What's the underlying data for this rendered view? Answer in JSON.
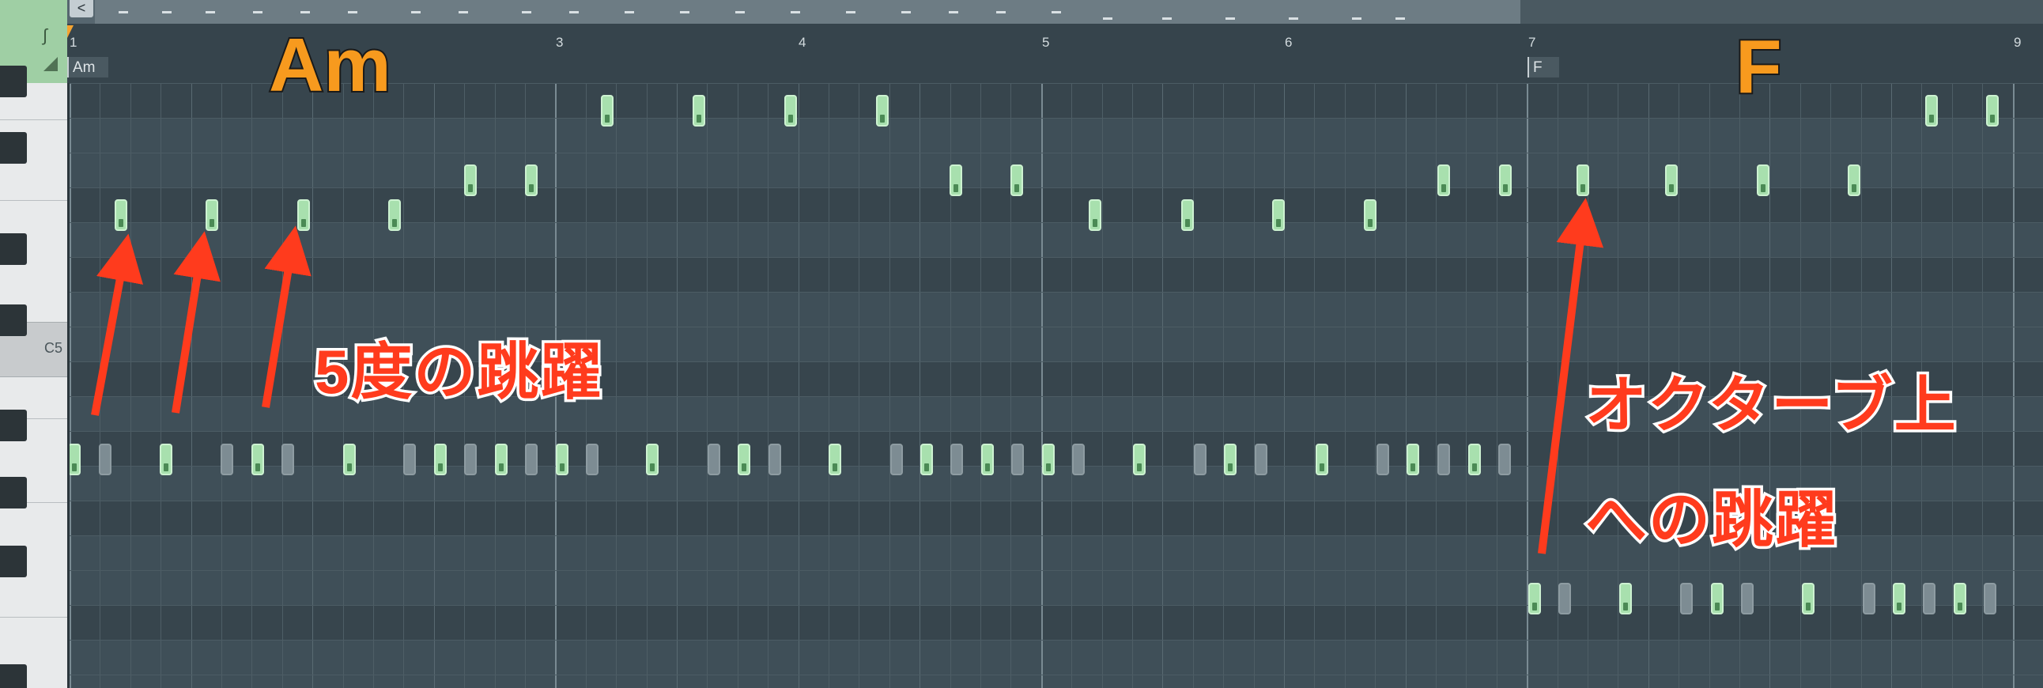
{
  "overview": {
    "scroll_left_glyph": "<"
  },
  "corner": {
    "tool_glyph": "∫"
  },
  "ruler": {
    "bar_numbers": [
      {
        "label": "1"
      },
      {
        "label": "3"
      },
      {
        "label": "4"
      },
      {
        "label": "5"
      },
      {
        "label": "6"
      },
      {
        "label": "7"
      },
      {
        "label": "9"
      }
    ],
    "markers": [
      {
        "label": "Am"
      },
      {
        "label": "F"
      }
    ]
  },
  "piano": {
    "c5_label": "C5"
  },
  "overlay": {
    "chord_am": "Am",
    "chord_f": "F",
    "anno_fifth": "5度の跳躍",
    "anno_octave_line1": "オクターブ上",
    "anno_octave_line2": "への跳躍"
  },
  "colors": {
    "note_active": "#a8e0ae",
    "note_ghost": "#7d8c93",
    "grid_bg": "#3f4f58",
    "annotation_red": "#ff3b1d",
    "chord_orange": "#f79a1e"
  }
}
